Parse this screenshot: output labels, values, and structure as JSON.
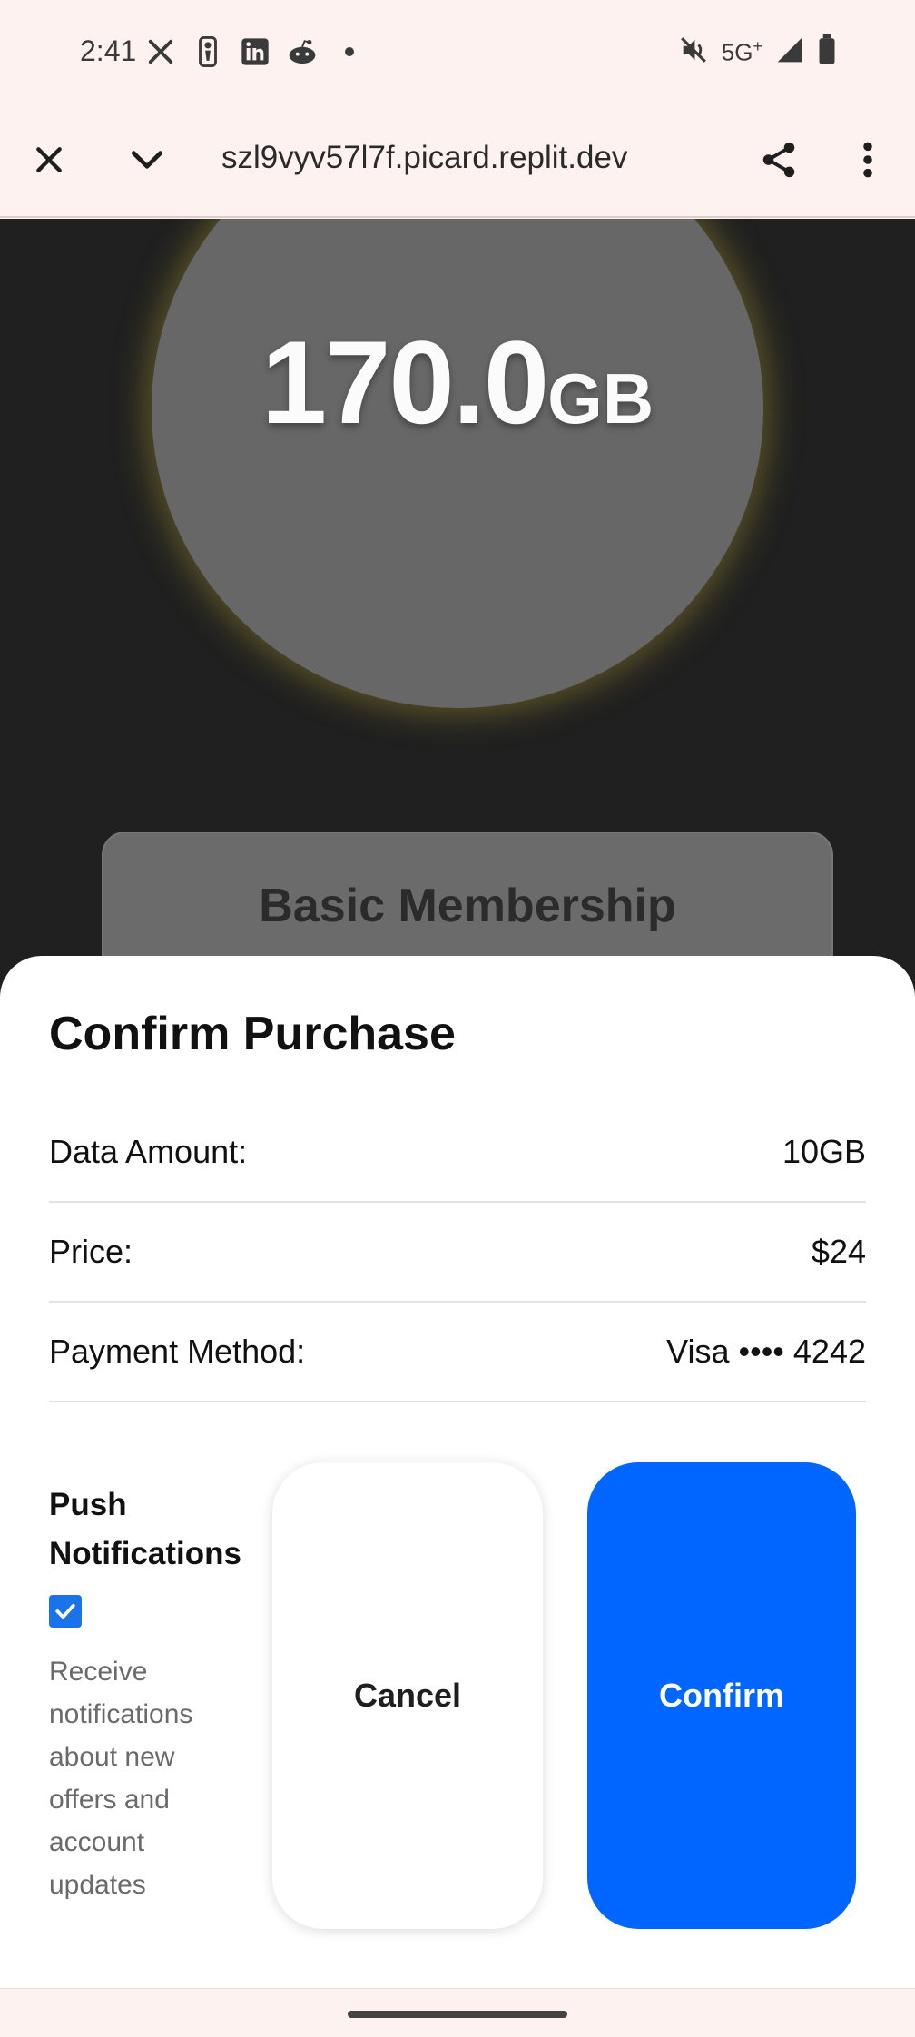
{
  "status_bar": {
    "time": "2:41",
    "network": "5G",
    "network_plus": "+",
    "left_icons": [
      "x-icon",
      "nba-icon",
      "linkedin-icon",
      "reddit-icon",
      "dot-icon"
    ],
    "right_icons": [
      "mute-icon",
      "signal-icon",
      "battery-icon"
    ]
  },
  "browser": {
    "url": "szl9vyv57l7f.picard.replit.dev",
    "icons": [
      "close-icon",
      "chevron-down-icon",
      "share-icon",
      "more-vert-icon"
    ]
  },
  "page": {
    "data_value": "170.0",
    "data_unit": "GB",
    "membership_title": "Basic Membership"
  },
  "dialog": {
    "title": "Confirm Purchase",
    "rows": [
      {
        "label": "Data Amount:",
        "value": "10GB"
      },
      {
        "label": "Price:",
        "value": "$24"
      },
      {
        "label": "Payment Method:",
        "value": "Visa •••• 4242"
      }
    ],
    "push_title": "Push Notifications",
    "push_checked": true,
    "push_description": "Receive notifications about new offers and account updates",
    "cancel_label": "Cancel",
    "confirm_label": "Confirm",
    "confirm_color": "#0066ff"
  }
}
